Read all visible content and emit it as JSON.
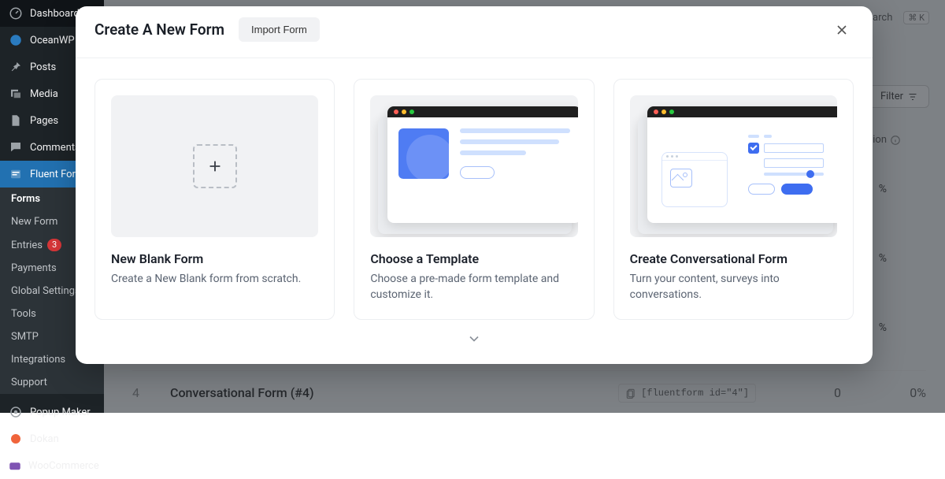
{
  "sidebar": {
    "items": [
      {
        "label": "Dashboard",
        "icon": "dashboard-icon"
      },
      {
        "label": "OceanWP",
        "icon": "oceanwp-icon"
      },
      {
        "label": "Posts",
        "icon": "pin-icon"
      },
      {
        "label": "Media",
        "icon": "media-icon"
      },
      {
        "label": "Pages",
        "icon": "pages-icon"
      },
      {
        "label": "Comments",
        "icon": "comments-icon"
      },
      {
        "label": "Fluent Forms",
        "icon": "fluentforms-icon"
      },
      {
        "label": "Popup Maker",
        "icon": "popupmaker-icon"
      },
      {
        "label": "Dokan",
        "icon": "dokan-icon"
      },
      {
        "label": "WooCommerce",
        "icon": "woocommerce-icon"
      }
    ],
    "subitems": [
      {
        "label": "Forms"
      },
      {
        "label": "New Form"
      },
      {
        "label": "Entries",
        "count": "3"
      },
      {
        "label": "Payments"
      },
      {
        "label": "Global Settings"
      },
      {
        "label": "Tools"
      },
      {
        "label": "SMTP"
      },
      {
        "label": "Integrations"
      },
      {
        "label": "Support"
      }
    ]
  },
  "page_bg": {
    "search_label": "earch",
    "shortcut": "⌘ K",
    "filter_label": "Filter",
    "col_version": "rsion",
    "row1_pct": "%",
    "row2_pct": "%",
    "row3_pct": "%",
    "row4_idx": "4",
    "row4_title": "Conversational Form (#4)",
    "row4_short": "[fluentform id=\"4\"]",
    "row4_entry": "0",
    "row4_pct": "0%"
  },
  "modal": {
    "title": "Create A New Form",
    "import_label": "Import Form",
    "cards": [
      {
        "title": "New Blank Form",
        "desc": "Create a New Blank form from scratch."
      },
      {
        "title": "Choose a Template",
        "desc": "Choose a pre-made form template and customize it."
      },
      {
        "title": "Create Conversational Form",
        "desc": "Turn your content, surveys into conversations."
      }
    ]
  }
}
